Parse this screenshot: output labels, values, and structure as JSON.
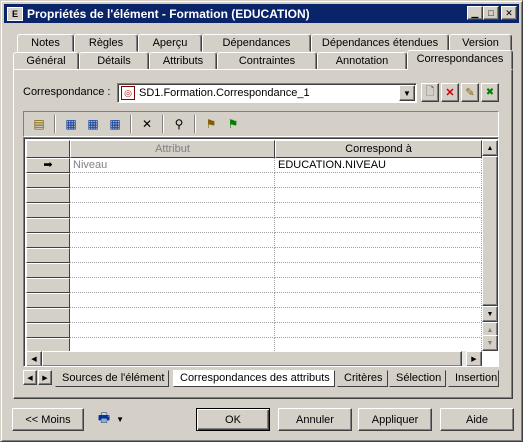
{
  "window": {
    "title": "Propriétés de l'élément - Formation (EDUCATION)",
    "app_icon_glyph": "E",
    "accent_color": "#0a246a"
  },
  "tabs": {
    "row_top": [
      {
        "label": "Notes"
      },
      {
        "label": "Règles"
      },
      {
        "label": "Aperçu"
      },
      {
        "label": "Dépendances"
      },
      {
        "label": "Dépendances étendues"
      },
      {
        "label": "Version"
      }
    ],
    "row_bottom": [
      {
        "label": "Général"
      },
      {
        "label": "Détails"
      },
      {
        "label": "Attributs"
      },
      {
        "label": "Contraintes"
      },
      {
        "label": "Annotation"
      },
      {
        "label": "Correspondances",
        "active": true
      }
    ]
  },
  "mapping": {
    "label": "Correspondance :",
    "selected": "SD1.Formation.Correspondance_1"
  },
  "grid": {
    "columns": [
      "Attribut",
      "Correspond à"
    ],
    "rows": [
      {
        "attribut": "Niveau",
        "correspond": "EDUCATION.NIVEAU",
        "current": true
      }
    ],
    "empty_rows": 12
  },
  "bottom_tabs": [
    {
      "label": "Sources de l'élément"
    },
    {
      "label": "Correspondances des attributs",
      "active": true
    },
    {
      "label": "Critères"
    },
    {
      "label": "Sélection"
    },
    {
      "label": "Insertion"
    }
  ],
  "buttons": {
    "less": "<< Moins",
    "ok": "OK",
    "cancel": "Annuler",
    "apply": "Appliquer",
    "help": "Aide"
  }
}
